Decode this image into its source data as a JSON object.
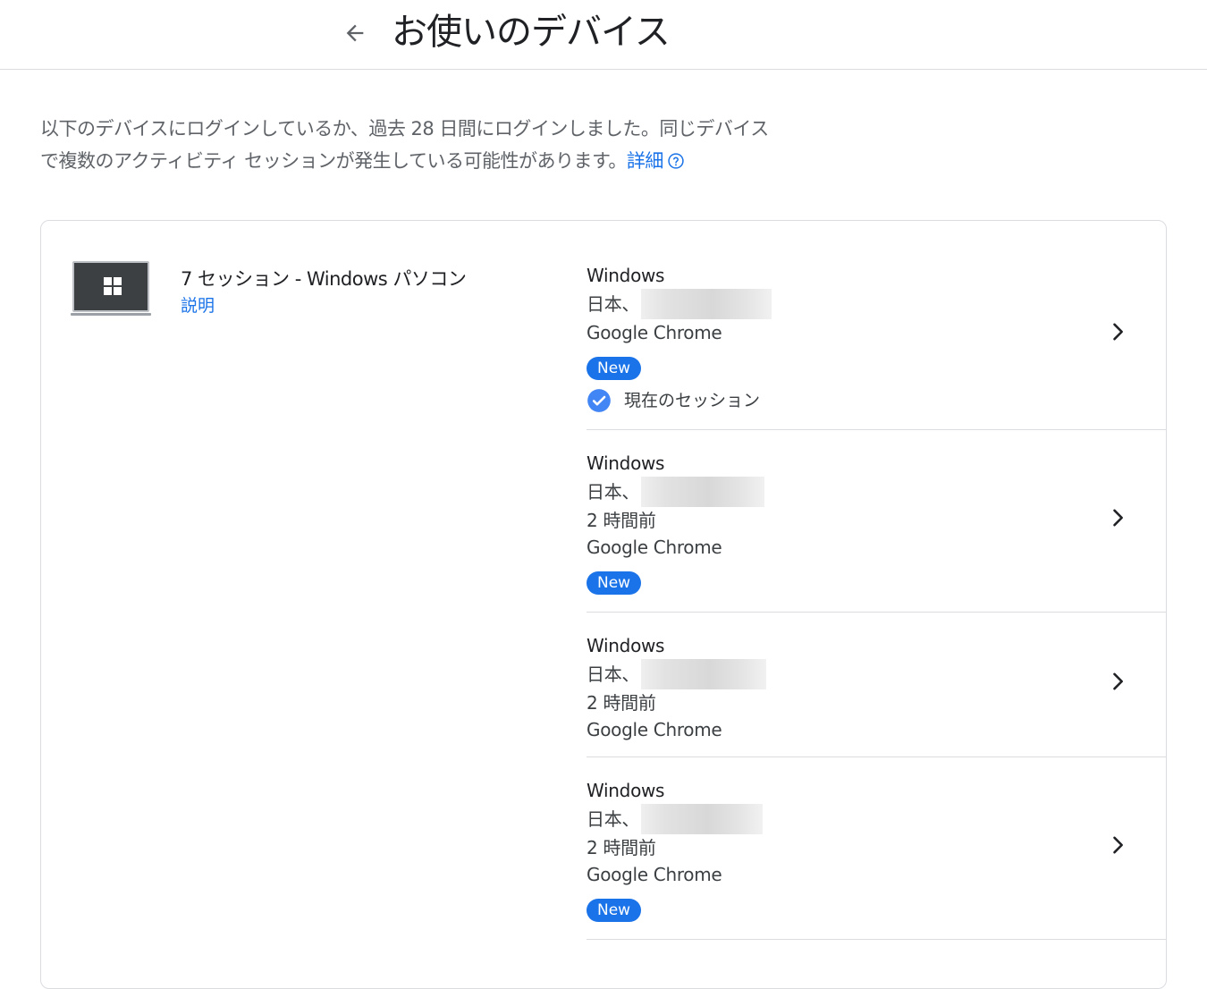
{
  "header": {
    "title": "お使いのデバイス"
  },
  "intro": {
    "text": "以下のデバイスにログインしているか、過去 28 日間にログインしました。同じデバイスで複数のアクティビティ セッションが発生している可能性があります。",
    "link": "詳細"
  },
  "device": {
    "title": "7 セッション - Windows パソコン",
    "description": "説明"
  },
  "sessions": [
    {
      "os": "Windows",
      "location": "日本、",
      "browser": "Google Chrome",
      "badge": "New",
      "current": "現在のセッション"
    },
    {
      "os": "Windows",
      "location": "日本、",
      "time": "2 時間前",
      "browser": "Google Chrome",
      "badge": "New"
    },
    {
      "os": "Windows",
      "location": "日本、",
      "time": "2 時間前",
      "browser": "Google Chrome"
    },
    {
      "os": "Windows",
      "location": "日本、",
      "time": "2 時間前",
      "browser": "Google Chrome",
      "badge": "New"
    }
  ],
  "colors": {
    "accent": "#1a73e8",
    "divider": "#dadce0",
    "text": "#202124"
  }
}
